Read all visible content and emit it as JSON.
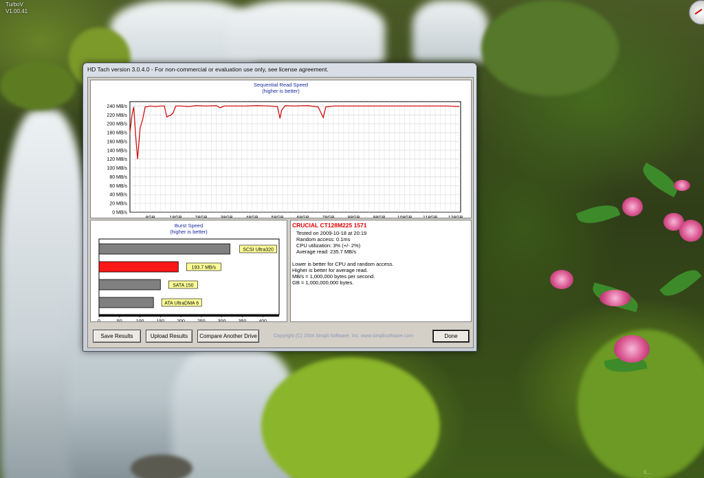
{
  "desktop": {
    "turbov_name": "TurboV",
    "turbov_version": "V1.00.41",
    "watermark": "s..."
  },
  "window": {
    "title": "HD Tach version 3.0.4.0  - For non-commercial or evaluation use only, see license agreement."
  },
  "sequential": {
    "title": "Sequential Read Speed",
    "subtitle": "(higher is better)"
  },
  "burst": {
    "title": "Burst Speed",
    "subtitle": "(higher is better)"
  },
  "info": {
    "drive_name": "CRUCIAL CT128M225 1571",
    "lines": [
      "Tested on 2009-10-18 at 20:19",
      "Random access: 0.1ms",
      "CPU utilization: 3% (+/- 2%)",
      "Average read: 235.7 MB/s"
    ],
    "notes": [
      "Lower is better for CPU and random access.",
      "Higher is better for average read.",
      "MB/s = 1,000,000 bytes per second.",
      "GB = 1,000,000,000 bytes."
    ]
  },
  "buttons": {
    "save": "Save Results",
    "upload": "Upload Results",
    "compare": "Compare Another Drive",
    "done": "Done"
  },
  "copyright": "Copyright (C) 2004 Simpli Software, Inc. www.simplisoftware.com",
  "chart_data": [
    {
      "type": "line",
      "title": "Sequential Read Speed",
      "subtitle": "(higher is better)",
      "ylabel": "",
      "xlabel": "",
      "y_ticks": [
        "0 MB/s",
        "20 MB/s",
        "40 MB/s",
        "60 MB/s",
        "80 MB/s",
        "100 MB/s",
        "120 MB/s",
        "140 MB/s",
        "160 MB/s",
        "180 MB/s",
        "200 MB/s",
        "220 MB/s",
        "240 MB/s"
      ],
      "x_ticks": [
        "8GB",
        "18GB",
        "28GB",
        "38GB",
        "48GB",
        "58GB",
        "68GB",
        "78GB",
        "88GB",
        "98GB",
        "108GB",
        "118GB",
        "128GB"
      ],
      "xlim": [
        0,
        130
      ],
      "ylim": [
        0,
        250
      ],
      "grid": true,
      "color": "#d01010",
      "series": [
        {
          "x": [
            0,
            0.8,
            1.5,
            2.3,
            3.0,
            4.0,
            5.0,
            6.0,
            7.0,
            8.0,
            10,
            12,
            13.5,
            14.5,
            15.3,
            16,
            17,
            18,
            20,
            23,
            26,
            30,
            34,
            35.5,
            37,
            40,
            45,
            50,
            55,
            58,
            58.5,
            59,
            59.6,
            61,
            64,
            70,
            74,
            75,
            76,
            77,
            80,
            90,
            100,
            110,
            120,
            125,
            129.5
          ],
          "y": [
            180,
            220,
            238,
            170,
            120,
            190,
            210,
            238,
            239,
            240,
            239,
            240,
            240,
            215,
            218,
            219,
            225,
            240,
            240,
            239,
            241,
            240,
            241,
            236,
            240,
            240,
            240,
            241,
            240,
            239,
            225,
            212,
            230,
            241,
            240,
            241,
            238,
            226,
            214,
            238,
            240,
            240,
            240,
            240,
            240,
            240,
            239
          ]
        }
      ]
    },
    {
      "type": "bar",
      "title": "Burst Speed",
      "subtitle": "(higher is better)",
      "orientation": "horizontal",
      "categories": [
        "SCSI Ultra320",
        "193.7 MB/s",
        "SATA 150",
        "ATA UltraDMA 6"
      ],
      "values": [
        320,
        193.7,
        150,
        133
      ],
      "colors": [
        "#808080",
        "#ff1818",
        "#808080",
        "#808080"
      ],
      "x_ticks": [
        "0",
        "50",
        "100",
        "150",
        "200",
        "250",
        "300",
        "350",
        "400"
      ],
      "xlim": [
        0,
        440
      ],
      "grid": false
    }
  ]
}
